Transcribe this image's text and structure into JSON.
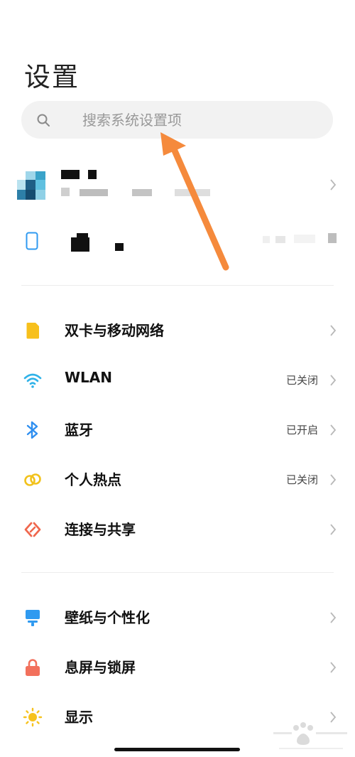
{
  "header": {
    "title": "设置"
  },
  "search": {
    "placeholder": "搜索系统设置项",
    "icon": "search-icon"
  },
  "account": {
    "avatar_icon": "pixelated-avatar-icon"
  },
  "device": {
    "icon": "phone-icon"
  },
  "sections": {
    "network": [
      {
        "id": "dual-sim",
        "label": "双卡与移动网络",
        "status": "",
        "icon": "sim-card-icon",
        "color": "#f7c01c"
      },
      {
        "id": "wlan",
        "label": "WLAN",
        "status": "已关闭",
        "icon": "wifi-icon",
        "color": "#2fb2e8"
      },
      {
        "id": "bluetooth",
        "label": "蓝牙",
        "status": "已开启",
        "icon": "bluetooth-icon",
        "color": "#2f8ff0"
      },
      {
        "id": "hotspot",
        "label": "个人热点",
        "status": "已关闭",
        "icon": "hotspot-icon",
        "color": "#f2c21c"
      },
      {
        "id": "connect-share",
        "label": "连接与共享",
        "status": "",
        "icon": "connect-share-icon",
        "color": "#f0674d"
      }
    ],
    "personal": [
      {
        "id": "wallpaper",
        "label": "壁纸与个性化",
        "status": "",
        "icon": "wallpaper-icon",
        "color": "#2f9af0"
      },
      {
        "id": "lock-screen",
        "label": "息屏与锁屏",
        "status": "",
        "icon": "lock-icon",
        "color": "#f2705c"
      },
      {
        "id": "display",
        "label": "显示",
        "status": "",
        "icon": "sun-icon",
        "color": "#f6c21e"
      }
    ]
  },
  "colors": {
    "arrow": "#f58a3c",
    "chevron": "#b8b8b8"
  }
}
